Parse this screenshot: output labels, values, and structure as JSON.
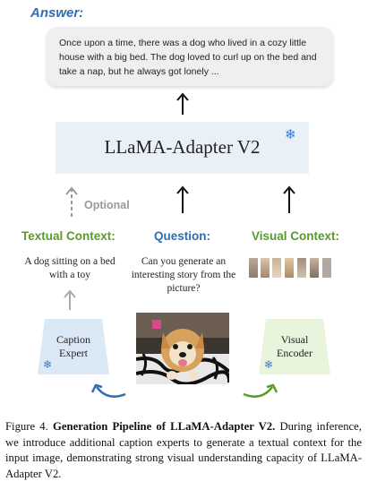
{
  "answer": {
    "label": "Answer:",
    "text": "Once upon a time, there was a dog who lived in a cozy little house with a big bed. The dog loved to curl up on the bed and take a nap, but he always got lonely ..."
  },
  "model": {
    "title": "LLaMA-Adapter V2",
    "frozen_icon": "snowflake-icon"
  },
  "optional_label": "Optional",
  "textual_context": {
    "label": "Textual Context:",
    "text": "A dog sitting on a bed with a toy"
  },
  "question": {
    "label": "Question:",
    "text": "Can you generate an interesting story from the picture?"
  },
  "visual_context": {
    "label": "Visual Context:"
  },
  "caption_expert": {
    "label": "Caption Expert"
  },
  "visual_encoder": {
    "label": "Visual Encoder"
  },
  "figure_caption": {
    "prefix": "Figure 4.",
    "title": "Generation Pipeline of LLaMA-Adapter V2.",
    "body": "During inference, we introduce additional caption experts to generate a textual context for the input image, demonstrating strong visual understanding capacity of LLaMA-Adapter V2."
  },
  "colors": {
    "accent_blue": "#2f6db5",
    "accent_green": "#5a9a2a",
    "model_fill": "#e9f0f8",
    "caption_expert_fill": "#dbe8f6",
    "visual_encoder_fill": "#e8f4dc"
  }
}
